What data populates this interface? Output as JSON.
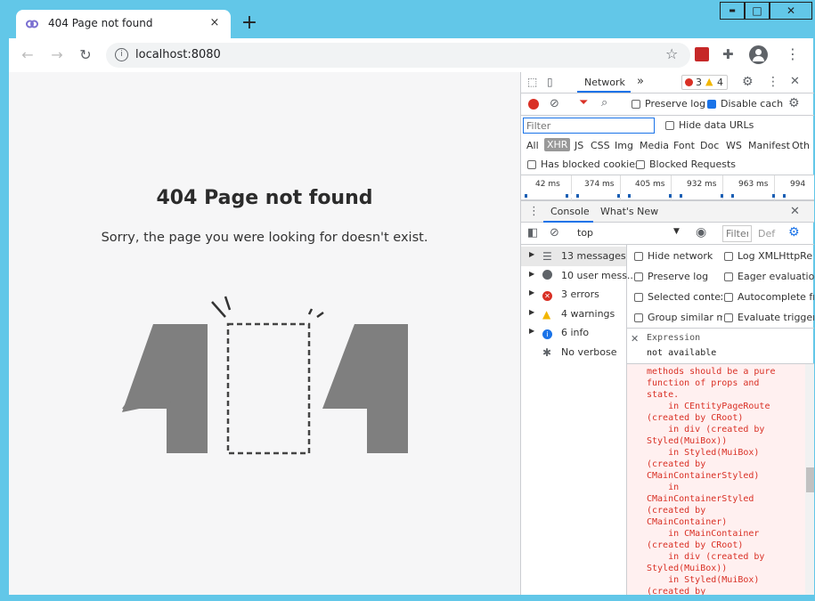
{
  "browser": {
    "tab_title": "404 Page not found",
    "tab_close": "×",
    "new_tab": "+",
    "url": "localhost:8080",
    "window_min": "▬",
    "window_max": "□",
    "window_close": "✕"
  },
  "page": {
    "heading": "404 Page not found",
    "message": "Sorry, the page you were looking for doesn't exist."
  },
  "devtools": {
    "tab_network": "Network",
    "more_tabs": "»",
    "error_count": "3",
    "warning_count": "4",
    "preserve_log": "Preserve log",
    "disable_cache": "Disable cach",
    "filter_placeholder": "Filter",
    "hide_data_urls": "Hide data URLs",
    "resource_types": [
      "All",
      "XHR",
      "JS",
      "CSS",
      "Img",
      "Media",
      "Font",
      "Doc",
      "WS",
      "Manifest",
      "Oth"
    ],
    "has_blocked_cookies": "Has blocked cookies",
    "blocked_requests": "Blocked Requests",
    "timeline_ticks": [
      "42 ms",
      "374 ms",
      "405 ms",
      "932 ms",
      "963 ms",
      "994"
    ],
    "drawer_tabs": [
      "Console",
      "What's New"
    ],
    "context": "top",
    "console_filter_placeholder": "Filter",
    "console_default_levels": "Def",
    "sidebar": [
      {
        "label": "13 messages",
        "icon": "list-icon"
      },
      {
        "label": "10 user mess...",
        "icon": "user-icon"
      },
      {
        "label": "3 errors",
        "icon": "error-icon"
      },
      {
        "label": "4 warnings",
        "icon": "warning-icon"
      },
      {
        "label": "6 info",
        "icon": "info-icon"
      },
      {
        "label": "No verbose",
        "icon": "bug-icon"
      }
    ],
    "settings": [
      [
        "Hide network",
        "Log XMLHttpRe"
      ],
      [
        "Preserve log",
        "Eager evaluatio"
      ],
      [
        "Selected contex",
        "Autocomplete fr"
      ],
      [
        "Group similar m",
        "Evaluate trigger"
      ]
    ],
    "expression_label": "Expression",
    "expression_value": "not available",
    "error_text": "methods should be a pure\nfunction of props and\nstate.\n    in CEntityPageRoute\n(created by CRoot)\n    in div (created by\nStyled(MuiBox))\n    in Styled(MuiBox)\n(created by\nCMainContainerStyled)\n    in\nCMainContainerStyled\n(created by\nCMainContainer)\n    in CMainContainer\n(created by CRoot)\n    in div (created by\nStyled(MuiBox))\n    in Styled(MuiBox)\n(created by"
  },
  "colors": {
    "accent": "#1a73e8",
    "error": "#d93025",
    "warning": "#f2b600",
    "graphic": "#7f7f7f"
  }
}
